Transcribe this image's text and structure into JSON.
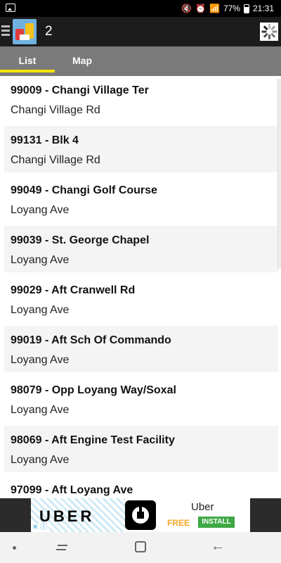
{
  "status_bar": {
    "battery_percent": "77%",
    "time": "21:31",
    "icons": [
      "gallery-icon",
      "mute-icon",
      "alarm-icon",
      "wifi-icon",
      "signal-icon",
      "battery-icon"
    ]
  },
  "app_bar": {
    "title": "2",
    "icons": [
      "menu-icon",
      "app-logo-icon",
      "loading-spinner-icon"
    ]
  },
  "tabs": [
    {
      "label": "List",
      "active": true
    },
    {
      "label": "Map",
      "active": false
    }
  ],
  "stops": [
    {
      "title": "99009 - Changi Village Ter",
      "road": "Changi Village Rd"
    },
    {
      "title": "99131 - Blk 4",
      "road": "Changi Village Rd"
    },
    {
      "title": "99049 - Changi Golf Course",
      "road": "Loyang Ave"
    },
    {
      "title": "99039 - St. George Chapel",
      "road": "Loyang Ave"
    },
    {
      "title": "99029 - Aft Cranwell Rd",
      "road": "Loyang Ave"
    },
    {
      "title": "99019 - Aft Sch Of Commando",
      "road": "Loyang Ave"
    },
    {
      "title": "98079 - Opp Loyang Way/Soxal",
      "road": "Loyang Ave"
    },
    {
      "title": "98069 - Aft Engine Test Facility",
      "road": "Loyang Ave"
    },
    {
      "title": "97099 - Aft Loyang Ave",
      "road": ""
    }
  ],
  "ad": {
    "banner_text": "UBER",
    "app_name": "Uber",
    "price": "FREE",
    "cta": "INSTALL",
    "info_glyph": "ⓘ",
    "close_glyph": "✕"
  },
  "colors": {
    "tab_indicator": "#f5e400",
    "tab_bar": "#7a7a7a",
    "app_bar": "#1c1c1c",
    "install_button": "#3fa845",
    "free_text": "#f5a623"
  }
}
